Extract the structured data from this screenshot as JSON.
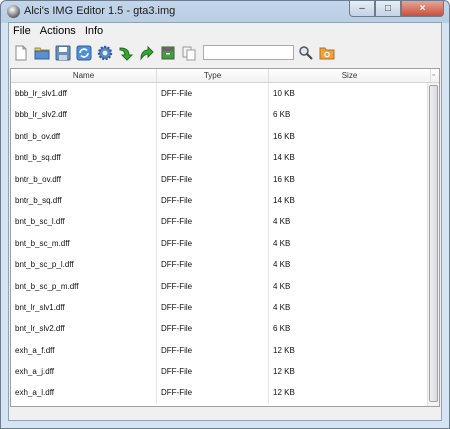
{
  "window": {
    "title": "Alci's IMG Editor 1.5 - gta3.img"
  },
  "menu": [
    "File",
    "Actions",
    "Info"
  ],
  "search": {
    "value": "",
    "placeholder": ""
  },
  "table": {
    "columns": [
      "Name",
      "Type",
      "Size"
    ],
    "rows": [
      {
        "name": "bbb_lr_slv1.dff",
        "type": "DFF-File",
        "size": "10 KB"
      },
      {
        "name": "bbb_lr_slv2.dff",
        "type": "DFF-File",
        "size": "6 KB"
      },
      {
        "name": "bntl_b_ov.dff",
        "type": "DFF-File",
        "size": "16 KB"
      },
      {
        "name": "bntl_b_sq.dff",
        "type": "DFF-File",
        "size": "14 KB"
      },
      {
        "name": "bntr_b_ov.dff",
        "type": "DFF-File",
        "size": "16 KB"
      },
      {
        "name": "bntr_b_sq.dff",
        "type": "DFF-File",
        "size": "14 KB"
      },
      {
        "name": "bnt_b_sc_l.dff",
        "type": "DFF-File",
        "size": "4 KB"
      },
      {
        "name": "bnt_b_sc_m.dff",
        "type": "DFF-File",
        "size": "4 KB"
      },
      {
        "name": "bnt_b_sc_p_l.dff",
        "type": "DFF-File",
        "size": "4 KB"
      },
      {
        "name": "bnt_b_sc_p_m.dff",
        "type": "DFF-File",
        "size": "4 KB"
      },
      {
        "name": "bnt_lr_slv1.dff",
        "type": "DFF-File",
        "size": "4 KB"
      },
      {
        "name": "bnt_lr_slv2.dff",
        "type": "DFF-File",
        "size": "6 KB"
      },
      {
        "name": "exh_a_f.dff",
        "type": "DFF-File",
        "size": "12 KB"
      },
      {
        "name": "exh_a_j.dff",
        "type": "DFF-File",
        "size": "12 KB"
      },
      {
        "name": "exh_a_l.dff",
        "type": "DFF-File",
        "size": "12 KB"
      }
    ]
  }
}
